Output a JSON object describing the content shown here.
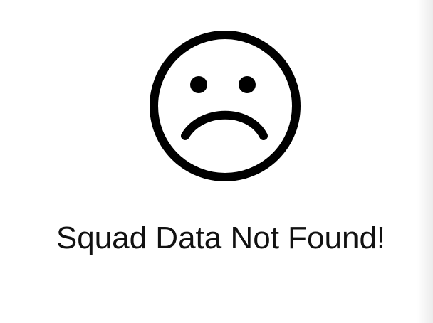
{
  "empty_state": {
    "icon": "sad-face-icon",
    "message": "Squad Data Not Found!"
  },
  "colors": {
    "background": "#ffffff",
    "icon": "#000000",
    "text": "#111111"
  }
}
